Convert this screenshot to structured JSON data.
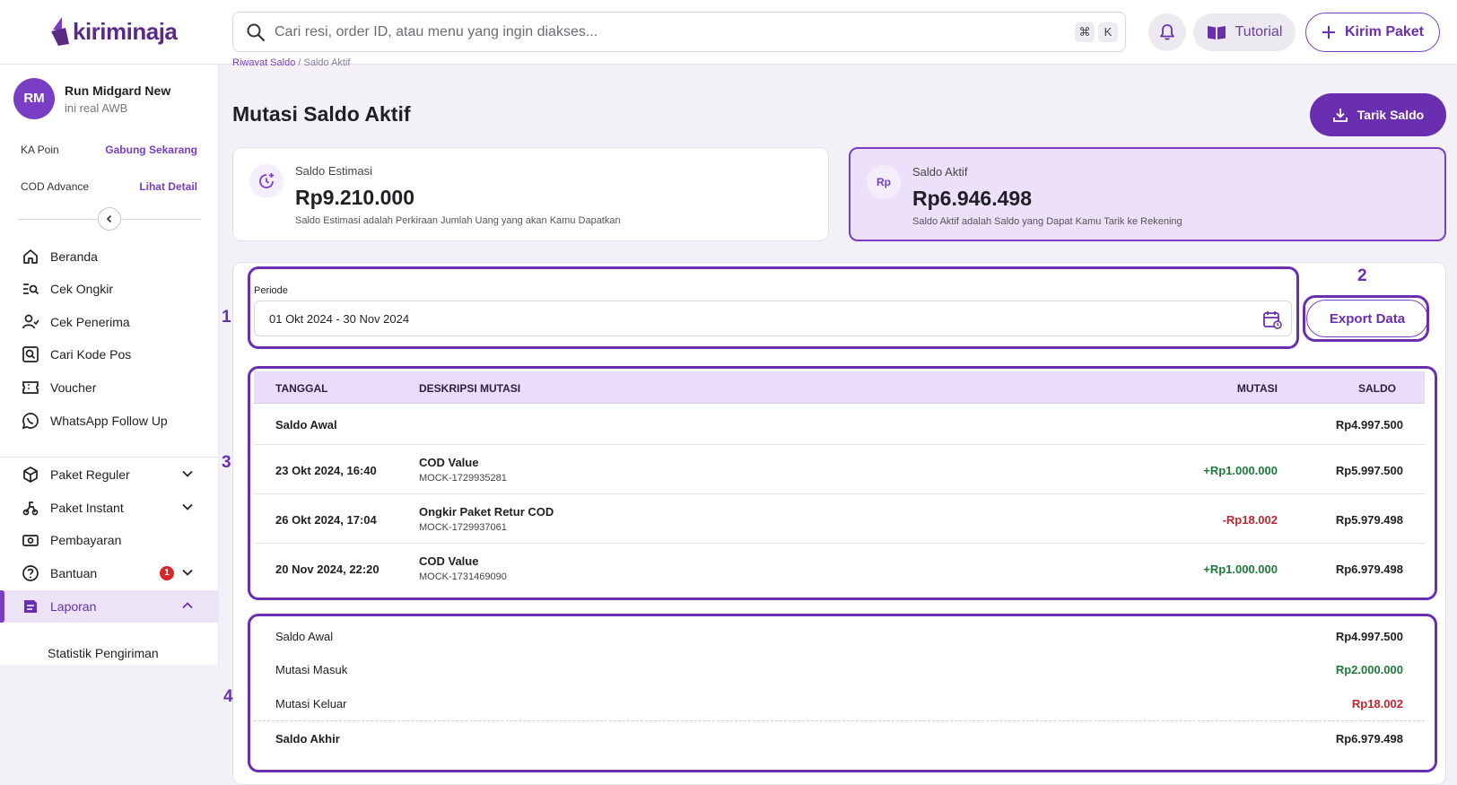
{
  "app": {
    "logo_text": "kiriminaja"
  },
  "search": {
    "placeholder": "Cari resi, order ID, atau menu yang ingin diakses...",
    "shortcut_cmd": "⌘",
    "shortcut_key": "K"
  },
  "header": {
    "tutorial_label": "Tutorial",
    "kirim_label": "Kirim Paket"
  },
  "user": {
    "initials": "RM",
    "name": "Run Midgard New",
    "subtitle": "ini real AWB"
  },
  "sidebar": {
    "ka_poin_label": "KA Poin",
    "ka_poin_link": "Gabung Sekarang",
    "cod_label": "COD Advance",
    "cod_link": "Lihat Detail",
    "items": [
      {
        "label": "Beranda",
        "icon": "home-icon"
      },
      {
        "label": "Cek Ongkir",
        "icon": "list-search-icon"
      },
      {
        "label": "Cek Penerima",
        "icon": "user-check-icon"
      },
      {
        "label": "Cari Kode Pos",
        "icon": "search-box-icon"
      },
      {
        "label": "Voucher",
        "icon": "ticket-icon"
      },
      {
        "label": "WhatsApp Follow Up",
        "icon": "whatsapp-icon"
      },
      {
        "label": "Paket Reguler",
        "icon": "box-icon"
      },
      {
        "label": "Paket Instant",
        "icon": "scooter-icon"
      },
      {
        "label": "Pembayaran",
        "icon": "money-icon"
      },
      {
        "label": "Bantuan",
        "icon": "help-icon",
        "badge": "1"
      },
      {
        "label": "Laporan",
        "icon": "report-icon"
      }
    ],
    "sub_item": "Statistik Pengiriman"
  },
  "breadcrumb": {
    "parent": "Riwayat Saldo",
    "separator": "/",
    "current": "Saldo Aktif"
  },
  "page": {
    "title": "Mutasi Saldo Aktif",
    "tarik_label": "Tarik Saldo"
  },
  "cards": {
    "estimasi": {
      "label": "Saldo Estimasi",
      "value": "Rp9.210.000",
      "desc": "Saldo Estimasi adalah Perkiraan Jumlah Uang yang akan Kamu Dapatkan"
    },
    "aktif": {
      "icon_text": "Rp",
      "label": "Saldo Aktif",
      "value": "Rp6.946.498",
      "desc": "Saldo Aktif adalah Saldo yang Dapat Kamu Tarik ke Rekening"
    }
  },
  "filter": {
    "periode_label": "Periode",
    "periode_value": "01 Okt 2024 - 30 Nov 2024",
    "export_label": "Export Data"
  },
  "markers": [
    "1",
    "2",
    "3",
    "4"
  ],
  "table": {
    "headers": {
      "tanggal": "TANGGAL",
      "deskripsi": "DESKRIPSI MUTASI",
      "mutasi": "MUTASI",
      "saldo": "SALDO"
    },
    "opening": {
      "label": "Saldo Awal",
      "saldo": "Rp4.997.500"
    },
    "rows": [
      {
        "tanggal": "23 Okt 2024, 16:40",
        "deskripsi": "COD Value",
        "ref": "MOCK-1729935281",
        "mutasi": "+Rp1.000.000",
        "saldo": "Rp5.997.500"
      },
      {
        "tanggal": "26 Okt 2024, 17:04",
        "deskripsi": "Ongkir Paket Retur COD",
        "ref": "MOCK-1729937061",
        "mutasi": "-Rp18.002",
        "saldo": "Rp5.979.498"
      },
      {
        "tanggal": "20 Nov 2024, 22:20",
        "deskripsi": "COD Value",
        "ref": "MOCK-1731469090",
        "mutasi": "+Rp1.000.000",
        "saldo": "Rp6.979.498"
      }
    ]
  },
  "summary": {
    "saldo_awal_label": "Saldo Awal",
    "saldo_awal": "Rp4.997.500",
    "masuk_label": "Mutasi Masuk",
    "masuk": "Rp2.000.000",
    "keluar_label": "Mutasi Keluar",
    "keluar": "Rp18.002",
    "akhir_label": "Saldo Akhir",
    "akhir": "Rp6.979.498"
  },
  "colors": {
    "brand": "#6a2fb0",
    "positive": "#1e7a3a",
    "negative": "#c0262d",
    "highlight": "#ece0fb"
  }
}
